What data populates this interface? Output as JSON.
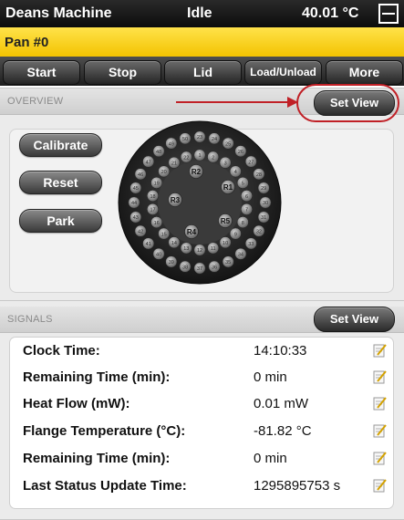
{
  "top_bar": {
    "machine_name": "Deans Machine",
    "status": "Idle",
    "temperature": "40.01 °C"
  },
  "pan": {
    "label": "Pan #0"
  },
  "nav": [
    {
      "label": "Start"
    },
    {
      "label": "Stop"
    },
    {
      "label": "Lid"
    },
    {
      "label": "Load/Unload"
    },
    {
      "label": "More"
    }
  ],
  "overview": {
    "title": "OVERVIEW",
    "set_view_label": "Set View",
    "buttons": [
      {
        "label": "Calibrate"
      },
      {
        "label": "Reset"
      },
      {
        "label": "Park"
      }
    ],
    "reference_labels": [
      "R1",
      "R2",
      "R3",
      "R4",
      "R5"
    ],
    "sample_count": 50
  },
  "signals": {
    "title": "SIGNALS",
    "set_view_label": "Set View",
    "rows": [
      {
        "label": "Clock Time:",
        "value": "14:10:33"
      },
      {
        "label": "Remaining Time (min):",
        "value": "0 min"
      },
      {
        "label": "Heat Flow (mW):",
        "value": "0.01 mW"
      },
      {
        "label": "Flange Temperature (°C):",
        "value": "-81.82 °C"
      },
      {
        "label": "Remaining Time (min):",
        "value": "0 min"
      },
      {
        "label": "Last Status Update Time:",
        "value": "1295895753 s"
      }
    ]
  },
  "colors": {
    "accent_yellow": "#f3c300",
    "annotation_red": "#c02026",
    "dark_bar": "#1a1a1a"
  }
}
